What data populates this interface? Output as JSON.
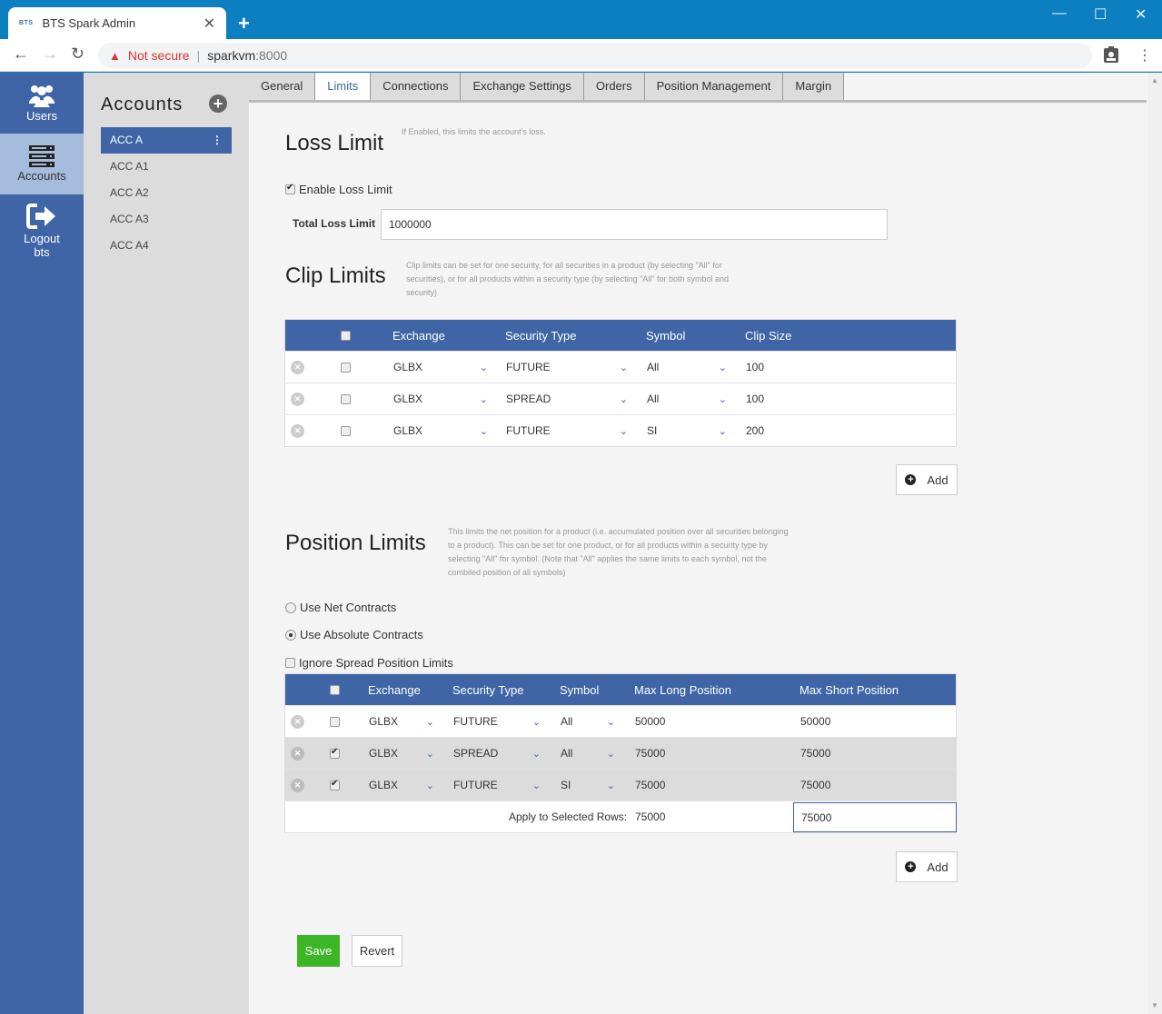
{
  "browser": {
    "tab_favicon": "BTS",
    "tab_title": "BTS Spark Admin",
    "security_label": "Not secure",
    "url_host": "sparkvm",
    "url_port": ":8000"
  },
  "leftnav": {
    "items": [
      {
        "label": "Users",
        "icon": "users-icon"
      },
      {
        "label": "Accounts",
        "icon": "server-icon"
      },
      {
        "label": "Logout",
        "sublabel": "bts",
        "icon": "logout-icon"
      }
    ]
  },
  "accounts": {
    "title": "Accounts",
    "items": [
      "ACC A",
      "ACC A1",
      "ACC A2",
      "ACC A3",
      "ACC A4"
    ],
    "selected": "ACC A"
  },
  "tabs": [
    "General",
    "Limits",
    "Connections",
    "Exchange Settings",
    "Orders",
    "Position Management",
    "Margin"
  ],
  "active_tab": "Limits",
  "loss_limit": {
    "title": "Loss Limit",
    "hint": "If Enabled, this limits the account's loss.",
    "enable_label": "Enable Loss Limit",
    "enabled": true,
    "total_label": "Total Loss Limit",
    "total_value": "1000000"
  },
  "clip_limits": {
    "title": "Clip Limits",
    "hint": "Clip limits can be set for one security, for all securities in a product (by selecting \"All\" for securities), or for all products within a security type (by selecting \"All\" for both symbol and security)",
    "headers": [
      "Exchange",
      "Security Type",
      "Symbol",
      "Clip Size"
    ],
    "rows": [
      {
        "exchange": "GLBX",
        "security_type": "FUTURE",
        "symbol": "All",
        "clip_size": "100",
        "checked": false
      },
      {
        "exchange": "GLBX",
        "security_type": "SPREAD",
        "symbol": "All",
        "clip_size": "100",
        "checked": false
      },
      {
        "exchange": "GLBX",
        "security_type": "FUTURE",
        "symbol": "SI",
        "clip_size": "200",
        "checked": false
      }
    ],
    "add_label": "Add"
  },
  "position_limits": {
    "title": "Position Limits",
    "hint": "This limits the net position for a product (i.e. accumulated position over all securities belonging to a product). This can be set for one product, or for all products within a security type by selecting \"All\" for symbol. (Note that \"All\" applies the same limits to each symbol, not the combiled position of all symbols)",
    "use_net_label": "Use Net Contracts",
    "use_absolute_label": "Use Absolute Contracts",
    "mode": "absolute",
    "ignore_spread_label": "Ignore Spread Position Limits",
    "ignore_spread": false,
    "headers": [
      "Exchange",
      "Security Type",
      "Symbol",
      "Max Long Position",
      "Max Short Position"
    ],
    "rows": [
      {
        "exchange": "GLBX",
        "security_type": "FUTURE",
        "symbol": "All",
        "max_long": "50000",
        "max_short": "50000",
        "checked": false
      },
      {
        "exchange": "GLBX",
        "security_type": "SPREAD",
        "symbol": "All",
        "max_long": "75000",
        "max_short": "75000",
        "checked": true
      },
      {
        "exchange": "GLBX",
        "security_type": "FUTURE",
        "symbol": "SI",
        "max_long": "75000",
        "max_short": "75000",
        "checked": true
      }
    ],
    "apply_label": "Apply to Selected Rows:",
    "apply_long": "75000",
    "apply_short": "75000",
    "add_label": "Add"
  },
  "actions": {
    "save_label": "Save",
    "revert_label": "Revert"
  },
  "colors": {
    "brand": "#3f65a6",
    "save": "#3db626",
    "chrome": "#0c7fc0"
  }
}
